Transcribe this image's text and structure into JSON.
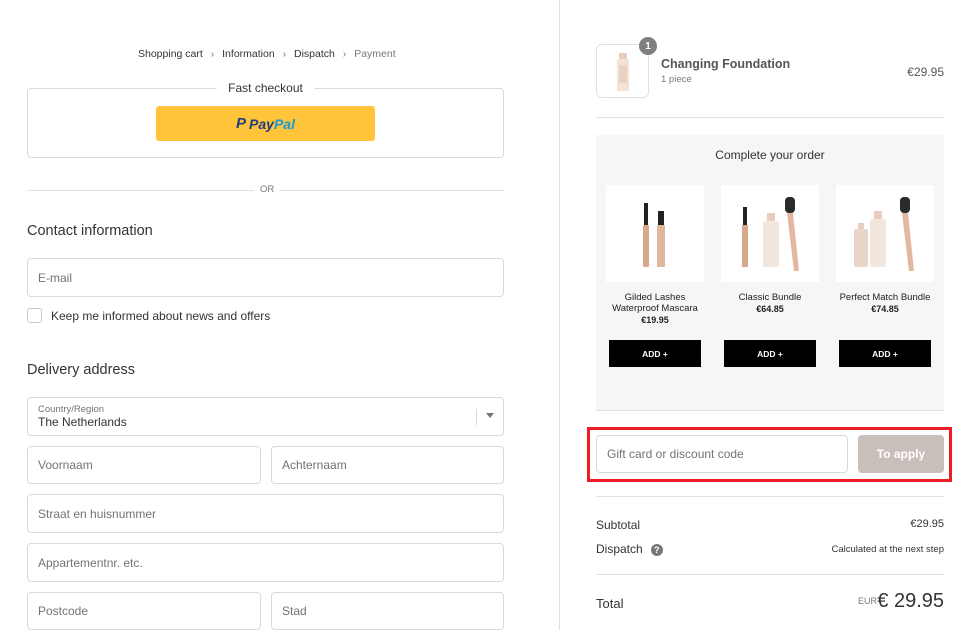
{
  "breadcrumb": {
    "items": [
      "Shopping cart",
      "Information",
      "Dispatch",
      "Payment"
    ]
  },
  "fast_checkout": {
    "title": "Fast checkout",
    "paypal_label_pay": "Pay",
    "paypal_label_pal": "Pal"
  },
  "divider_text": "OR",
  "contact": {
    "title": "Contact information",
    "email_placeholder": "E-mail",
    "newsletter_label": "Keep me informed about news and offers"
  },
  "delivery": {
    "title": "Delivery address",
    "country_label": "Country/Region",
    "country_value": "The Netherlands",
    "first_name_placeholder": "Voornaam",
    "last_name_placeholder": "Achternaam",
    "street_placeholder": "Straat en huisnummer",
    "apartment_placeholder": "Appartementnr. etc.",
    "postcode_placeholder": "Postcode",
    "city_placeholder": "Stad"
  },
  "order": {
    "product": {
      "name": "Changing Foundation",
      "quantity_text": "1 piece",
      "quantity_badge": "1",
      "price": "€29.95"
    },
    "upsell": {
      "title": "Complete your order",
      "items": [
        {
          "name": "Gilded Lashes Waterproof Mascara",
          "price": "€19.95",
          "button": "ADD +"
        },
        {
          "name": "Classic Bundle",
          "price": "€64.85",
          "button": "ADD +"
        },
        {
          "name": "Perfect Match Bundle",
          "price": "€74.85",
          "button": "ADD +"
        }
      ]
    },
    "discount": {
      "placeholder": "Gift card or discount code",
      "apply_label": "To apply"
    },
    "summary": {
      "subtotal_label": "Subtotal",
      "subtotal_value": "€29.95",
      "dispatch_label": "Dispatch",
      "dispatch_value": "Calculated at the next step",
      "total_label": "Total",
      "total_currency": "EUR",
      "total_value": "€ 29.95"
    }
  },
  "colors": {
    "paypal_yellow": "#ffc439",
    "apply_button": "#c8bfbb",
    "highlight_red": "#ee1c24",
    "upsell_bg": "#f7f6f5"
  }
}
